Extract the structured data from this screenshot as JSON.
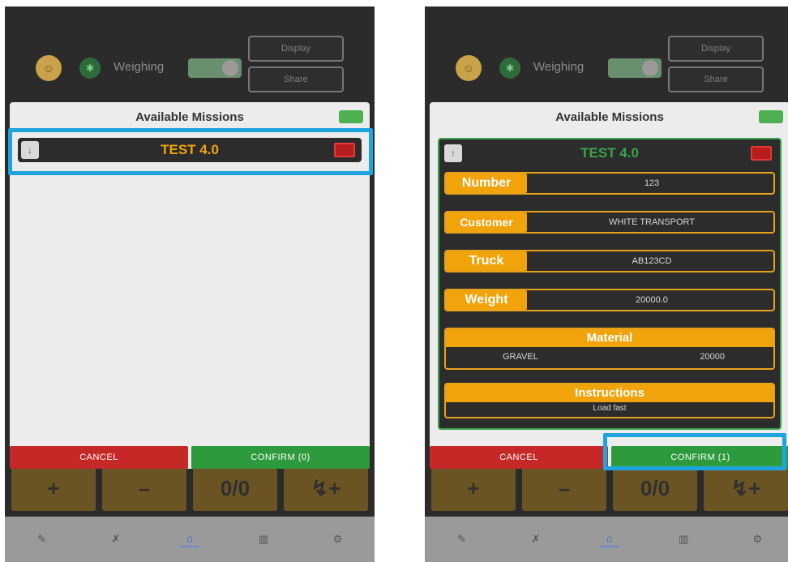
{
  "left": {
    "header": {
      "weighing_label": "Weighing",
      "button_1": "Display",
      "button_2": "Share"
    },
    "dialog": {
      "title": "Available Missions",
      "mission": {
        "name": "TEST 4.0",
        "name_color": "#f0a30a",
        "chevron": "↓"
      },
      "cancel_label": "CANCEL",
      "confirm_label": "CONFIRM (0)"
    },
    "bg_keys": [
      "+",
      "–",
      "0/0",
      "↯+"
    ],
    "nav": [
      "✎",
      "✗",
      "⌂",
      "▥",
      "⚙"
    ]
  },
  "right": {
    "header": {
      "weighing_label": "Weighing",
      "button_1": "Display",
      "button_2": "Share"
    },
    "dialog": {
      "title": "Available Missions",
      "mission": {
        "name": "TEST 4.0",
        "name_color": "#3aa44a",
        "chevron": "↑"
      },
      "fields": [
        {
          "label": "Number",
          "value": "123"
        },
        {
          "label": "Customer",
          "value": "WHITE TRANSPORT"
        },
        {
          "label": "Truck",
          "value": "AB123CD"
        },
        {
          "label": "Weight",
          "value": "20000.0"
        }
      ],
      "material": {
        "header": "Material",
        "name": "GRAVEL",
        "amount": "20000"
      },
      "instructions": {
        "header": "Instructions",
        "text": "Load fast"
      },
      "cancel_label": "CANCEL",
      "confirm_label": "CONFIRM (1)"
    },
    "bg_keys": [
      "+",
      "–",
      "0/0",
      "↯+"
    ],
    "nav": [
      "✎",
      "✗",
      "⌂",
      "▥",
      "⚙"
    ]
  },
  "colors": {
    "highlight": "#1ea5e0",
    "accent_orange": "#f0a30a",
    "confirm_green": "#2e9a3e",
    "cancel_red": "#c62828"
  }
}
